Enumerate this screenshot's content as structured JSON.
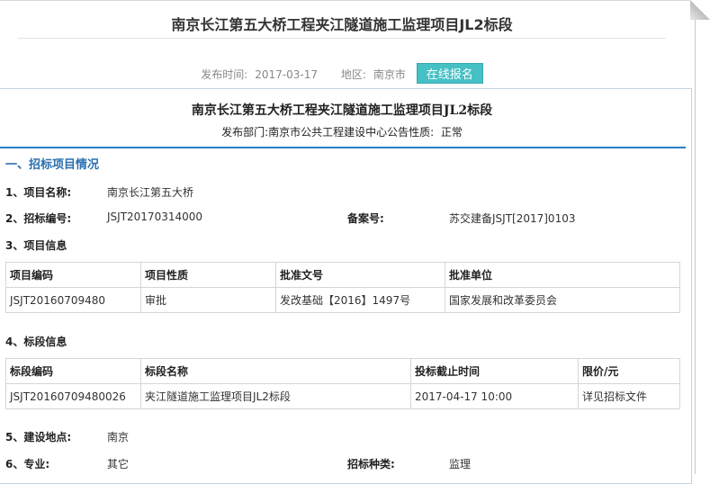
{
  "header": {
    "title": "南京长江第五大桥工程夹江隧道施工监理项目JL2标段",
    "publish_time_label": "发布时间:",
    "publish_time": "2017-03-17",
    "region_label": "地区:",
    "region": "南京市",
    "signup_button": "在线报名"
  },
  "document": {
    "title": "南京长江第五大桥工程夹江隧道施工监理项目JL2标段",
    "sub_label": "发布部门:",
    "department": "南京市公共工程建设中心",
    "nature_label": "公告性质:",
    "nature": "正常"
  },
  "section1": {
    "heading": "一、招标项目情况",
    "project_name_label": "1、项目名称:",
    "project_name": "南京长江第五大桥",
    "tender_no_label": "2、招标编号:",
    "tender_no": "JSJT20170314000",
    "record_no_label": "备案号:",
    "record_no": "苏交建备JSJT[2017]0103",
    "project_info_label": "3、项目信息",
    "project_table": {
      "headers": [
        "项目编码",
        "项目性质",
        "批准文号",
        "批准单位"
      ],
      "rows": [
        [
          "JSJT20160709480",
          "审批",
          "发改基础【2016】1497号",
          "国家发展和改革委员会"
        ]
      ]
    },
    "section_info_label": "4、标段信息",
    "section_table": {
      "headers": [
        "标段编码",
        "标段名称",
        "投标截止时间",
        "限价/元"
      ],
      "rows": [
        [
          "JSJT20160709480026",
          "夹江隧道施工监理项目JL2标段",
          "2017-04-17 10:00",
          "详见招标文件"
        ]
      ]
    },
    "location_label": "5、建设地点:",
    "location": "南京",
    "major_label": "6、专业:",
    "major": "其它",
    "tender_type_label": "招标种类:",
    "tender_type": "监理"
  }
}
